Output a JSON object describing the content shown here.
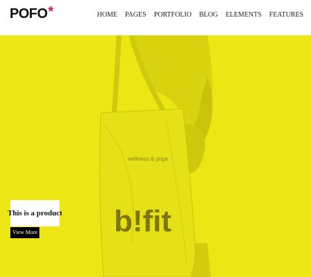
{
  "header": {
    "logo": {
      "text": "POFO",
      "star": "*",
      "star_color": "#e5193f"
    },
    "nav": [
      "HOME",
      "PAGES",
      "PORTFOLIO",
      "BLOG",
      "ELEMENTS",
      "FEATURES"
    ]
  },
  "hero": {
    "background_color": "#ece615",
    "bag_tagline": "wellness & yoga",
    "bag_logo": "b!fit"
  },
  "product": {
    "title": "This is a product",
    "button": "View More"
  }
}
